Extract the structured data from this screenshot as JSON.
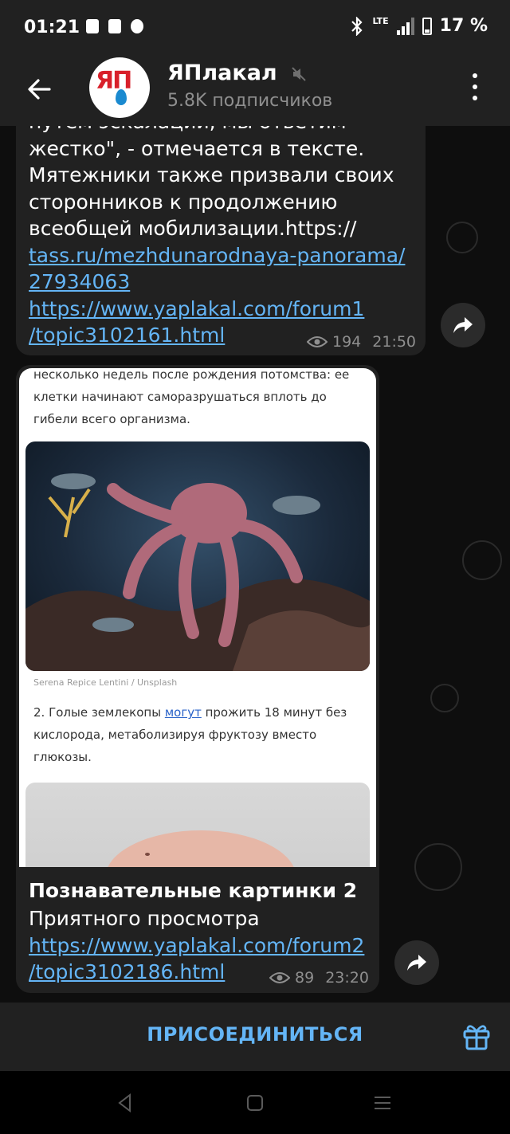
{
  "status_bar": {
    "time": "01:21",
    "network": "LTE",
    "battery": "17 %"
  },
  "header": {
    "back_icon": "arrow-left-icon",
    "avatar_text": "ЯП",
    "channel_name": "ЯПлакал",
    "muted_icon": "mute-icon",
    "subscribers": "5.8K подписчиков",
    "menu_icon": "more-vertical-icon"
  },
  "messages": [
    {
      "text_lines": [
        "путем эскалации, мы ответим",
        "жестко\", - отмечается в тексте.",
        "Мятежники также призвали своих",
        "сторонников к продолжению",
        "всеобщей мобилизации.https://"
      ],
      "links": [
        "tass.ru/mezhdunarodnaya-panorama/",
        "27934063",
        "https://www.yaplakal.com/forum1",
        "/topic3102161.html"
      ],
      "views": "194",
      "time": "21:50"
    },
    {
      "image_text_1": "несколько недель после рождения потомства: ее клетки начинают саморазрушаться вплоть до гибели всего организма.",
      "image_credit": "Serena Repice Lentini / Unsplash",
      "image_text_2_prefix": "2. Голые землекопы ",
      "image_text_2_link": "могут",
      "image_text_2_suffix": " прожить 18 минут без кислорода, метаболизируя фруктозу вместо глюкозы.",
      "title": "Познавательные картинки 2",
      "subtitle": "Приятного просмотра",
      "links": [
        "https://www.yaplakal.com/forum2",
        "/topic3102186.html"
      ],
      "views": "89",
      "time": "23:20"
    }
  ],
  "join_bar": {
    "join_label": "ПРИСОЕДИНИТЬСЯ",
    "gift_icon": "gift-icon"
  },
  "colors": {
    "accent": "#64b5f6",
    "bubble": "#212121",
    "background": "#0e0e0e"
  }
}
